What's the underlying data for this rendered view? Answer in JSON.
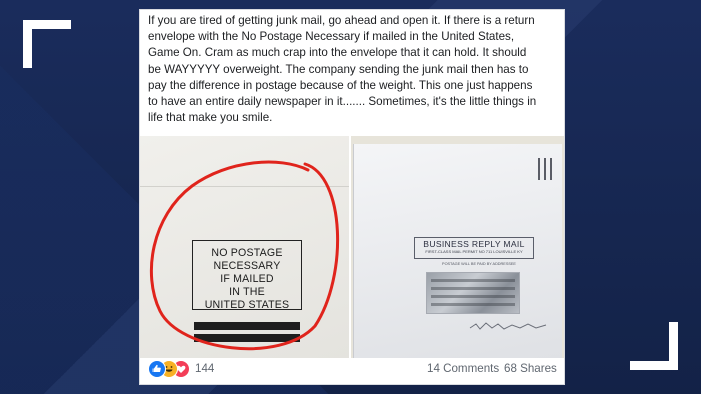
{
  "post": {
    "text_lines": [
      "If you are tired of getting junk mail, go ahead and open it. If there is a return",
      "envelope with the No Postage Necessary if mailed in the United States,",
      "Game On. Cram as much crap into the envelope that it can hold. It should",
      "be WAYYYYY overweight. The company sending the junk mail then has to",
      "pay the difference in postage because of the weight. This one just happens",
      "to have an entire daily newspaper in it....... Sometimes, it's the little things in",
      "life that make you smile."
    ]
  },
  "photo_left": {
    "stamp_lines": [
      "NO POSTAGE",
      "NECESSARY",
      "IF MAILED",
      "IN THE",
      "UNITED STATES"
    ],
    "circle_color": "#e0241c"
  },
  "photo_right": {
    "brm_title": "BUSINESS REPLY MAIL",
    "brm_sub": "FIRST-CLASS MAIL   PERMIT NO 711   LOUISVILLE KY",
    "brm_paid": "POSTAGE WILL BE PAID BY ADDRESSEE"
  },
  "footer": {
    "reaction_icons": [
      "like-icon",
      "haha-icon",
      "love-icon"
    ],
    "reaction_count": "144",
    "comments": "14 Comments",
    "shares": "68 Shares"
  },
  "colors": {
    "background": "#15264f",
    "like": "#1877f2",
    "haha": "#f7b125",
    "love": "#f33e58",
    "corner_marks": "#ffffff"
  }
}
